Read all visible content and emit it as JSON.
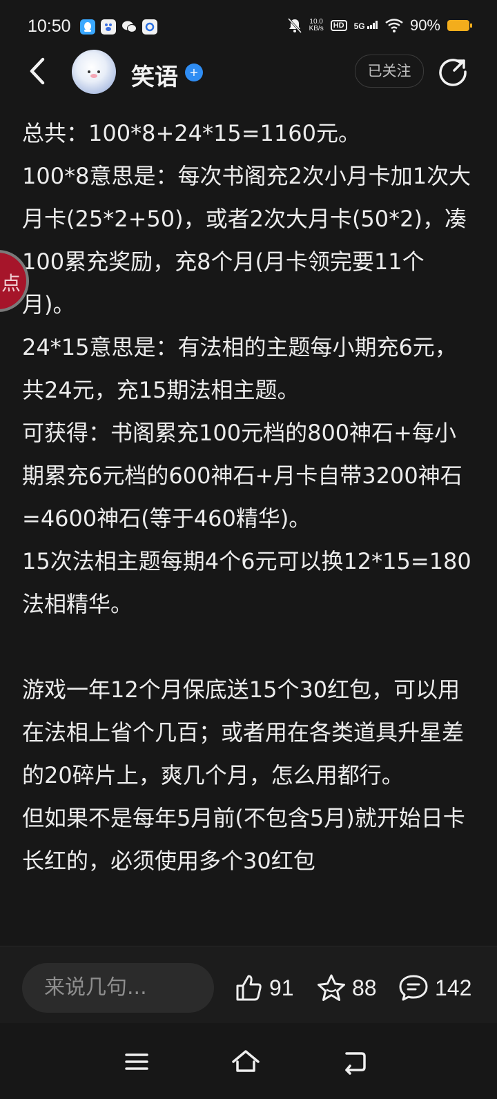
{
  "status_bar": {
    "time": "10:50",
    "net_speed_value": "10.0",
    "net_speed_unit": "KB/s",
    "hd": "HD",
    "network": "5G",
    "battery": "90%",
    "battery_color": "#f3ad1c"
  },
  "header": {
    "username": "笑语",
    "follow_label": "已关注"
  },
  "side_tab": {
    "label": "点"
  },
  "post": {
    "paragraphs": [
      "总共：100*8+24*15=1160元。",
      "100*8意思是：每次书阁充2次小月卡加1次大月卡(25*2+50)，或者2次大月卡(50*2)，凑100累充奖励，充8个月(月卡领完要11个月)。",
      "24*15意思是：有法相的主题每小期充6元，共24元，充15期法相主题。",
      "可获得：书阁累充100元档的800神石+每小期累充6元档的600神石+月卡自带3200神石=4600神石(等于460精华)。",
      "15次法相主题每期4个6元可以换12*15=180法相精华。",
      "游戏一年12个月保底送15个30红包，可以用在法相上省个几百；或者用在各类道具升星差的20碎片上，爽几个月，怎么用都行。",
      "但如果不是每年5月前(不包含5月)就开始日卡长红的，必须使用多个30红包"
    ]
  },
  "actions": {
    "comment_placeholder": "来说几句...",
    "likes": "91",
    "favorites": "88",
    "comments": "142",
    "accent": "#a6152a"
  }
}
